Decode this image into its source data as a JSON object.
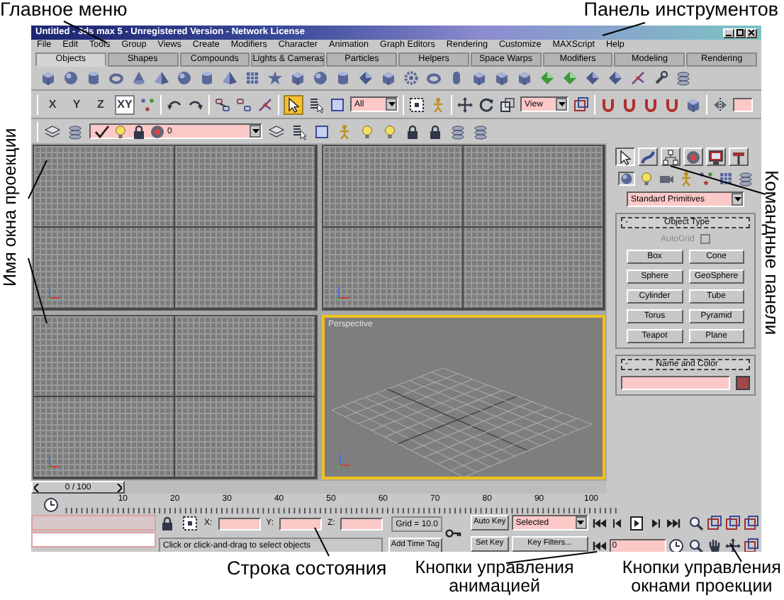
{
  "annotations": {
    "main_menu": "Главное меню",
    "toolbar": "Панель инструментов",
    "viewport_name": "Имя окна проекции",
    "command_panels": "Командные панели",
    "status_bar": "Строка состояния",
    "animation_controls": "Кнопки управления анимацией",
    "viewport_controls": "Кнопки управления окнами проекции"
  },
  "window": {
    "title": "Untitled - 3ds max 5 - Unregistered Version - Network License"
  },
  "menu": [
    "File",
    "Edit",
    "Tools",
    "Group",
    "Views",
    "Create",
    "Modifiers",
    "Character",
    "Animation",
    "Graph Editors",
    "Rendering",
    "Customize",
    "MAXScript",
    "Help"
  ],
  "shelf_tabs": [
    {
      "label": "Objects",
      "selected": true
    },
    {
      "label": "Shapes",
      "selected": false
    },
    {
      "label": "Compounds",
      "selected": false
    },
    {
      "label": "Lights & Cameras",
      "selected": false
    },
    {
      "label": "Particles",
      "selected": false
    },
    {
      "label": "Helpers",
      "selected": false
    },
    {
      "label": "Space Warps",
      "selected": false
    },
    {
      "label": "Modifiers",
      "selected": false
    },
    {
      "label": "Modeling",
      "selected": false
    },
    {
      "label": "Rendering",
      "selected": false
    }
  ],
  "main_toolbar": {
    "axis_buttons": [
      {
        "label": "X",
        "selected": false
      },
      {
        "label": "Y",
        "selected": false
      },
      {
        "label": "Z",
        "selected": false
      },
      {
        "label": "XY",
        "selected": true
      }
    ],
    "select_tool": {
      "selected": true
    },
    "selection_filter": "All",
    "coordinate_system": "View"
  },
  "layer_toolbar": {
    "current_layer": "0"
  },
  "viewports": [
    {
      "active": false
    },
    {
      "active": false
    },
    {
      "active": false
    },
    {
      "label": "Perspective",
      "active": true
    }
  ],
  "command_panel": {
    "tabs": [
      {
        "selected": true
      },
      {
        "selected": false
      },
      {
        "selected": false
      },
      {
        "selected": false
      },
      {
        "selected": false
      },
      {
        "selected": false
      }
    ],
    "categories": [
      {
        "selected": true
      },
      {
        "selected": false
      },
      {
        "selected": false
      },
      {
        "selected": false
      },
      {
        "selected": false
      },
      {
        "selected": false
      },
      {
        "selected": false
      }
    ],
    "object_category": "Standard Primitives",
    "object_type": {
      "sign": "-",
      "title": "Object Type",
      "autogrid": {
        "label": "AutoGrid",
        "checked": false,
        "disabled": true
      },
      "buttons": [
        "Box",
        "Cone",
        "Sphere",
        "GeoSphere",
        "Cylinder",
        "Tube",
        "Torus",
        "Pyramid",
        "Teapot",
        "Plane"
      ]
    },
    "name_and_color": {
      "sign": "-",
      "title": "Name and Color",
      "color": "#a04848"
    }
  },
  "time_slider": {
    "label": "0 / 100",
    "level": 0
  },
  "ruler": {
    "labels": [
      "10",
      "20",
      "30",
      "40",
      "50",
      "60",
      "70",
      "80",
      "90",
      "100"
    ]
  },
  "status": {
    "coordinates": [
      {
        "label": "X:"
      },
      {
        "label": "Y:"
      },
      {
        "label": "Z:"
      }
    ],
    "grid": "Grid = 10.0",
    "prompt": "Click or click-and-drag to select objects",
    "add_time_tag": "Add Time Tag"
  },
  "animation": {
    "auto_key": "Auto Key",
    "set_key": "Set Key",
    "key_mode": "Selected",
    "key_filters": "Key Filters...",
    "current_frame": "0"
  }
}
